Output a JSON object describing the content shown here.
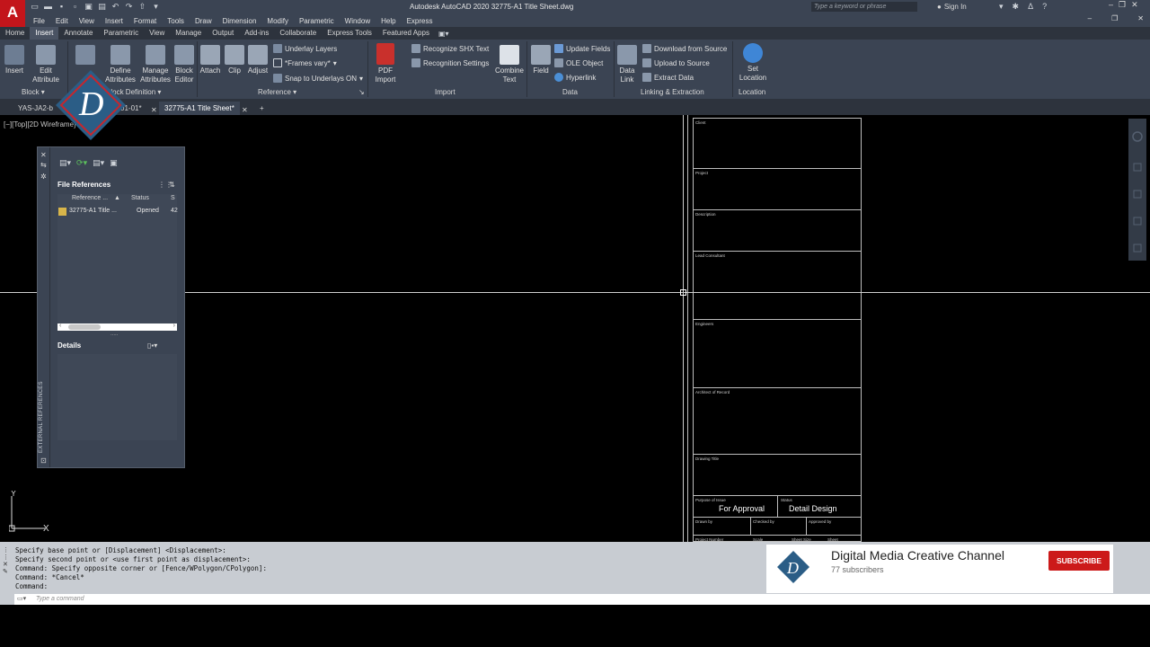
{
  "app": {
    "logo_letter": "A",
    "title": "Autodesk AutoCAD 2020   32775-A1 Title Sheet.dwg",
    "search_placeholder": "Type a keyword or phrase",
    "sign_in": "Sign In"
  },
  "menu": [
    "File",
    "Edit",
    "View",
    "Insert",
    "Format",
    "Tools",
    "Draw",
    "Dimension",
    "Modify",
    "Parametric",
    "Window",
    "Help",
    "Express"
  ],
  "ribbon_tabs": [
    {
      "label": "Home"
    },
    {
      "label": "Insert",
      "active": true
    },
    {
      "label": "Annotate"
    },
    {
      "label": "Parametric"
    },
    {
      "label": "View"
    },
    {
      "label": "Manage"
    },
    {
      "label": "Output"
    },
    {
      "label": "Add-ins"
    },
    {
      "label": "Collaborate"
    },
    {
      "label": "Express Tools"
    },
    {
      "label": "Featured Apps"
    }
  ],
  "ribbon": {
    "insert": "Insert",
    "edit_attribute": "Edit Attribute",
    "define_attributes": "Define Attributes",
    "manage_attributes": "Manage Attributes",
    "block_editor": "Block Editor",
    "attach": "Attach",
    "clip": "Clip",
    "adjust": "Adjust",
    "underlay_layers": "Underlay Layers",
    "frames_vary": "*Frames vary*",
    "snap_to_underlays": "Snap to Underlays ON",
    "pdf_import": "PDF Import",
    "recognize_shx": "Recognize SHX Text",
    "recognition_settings": "Recognition Settings",
    "combine_text": "Combine Text",
    "field": "Field",
    "update_fields": "Update Fields",
    "ole_object": "OLE Object",
    "hyperlink": "Hyperlink",
    "data_link": "Data Link",
    "download_from_source": "Download from Source",
    "upload_to_source": "Upload to Source",
    "extract_data": "Extract  Data",
    "set_location": "Set Location",
    "panels": {
      "block": "Block",
      "block_definition": "Block Definition",
      "reference": "Reference",
      "import": "Import",
      "data": "Data",
      "linking": "Linking & Extraction",
      "location": "Location"
    }
  },
  "doc_tabs": [
    {
      "label": "YAS-JA2-b"
    },
    {
      "label": "01-01*"
    },
    {
      "label": "32775-A1 Title Sheet*",
      "active": true
    }
  ],
  "viewport_label": "[−][Top][2D Wireframe]",
  "xref_palette": {
    "side_title": "EXTERNAL REFERENCES",
    "file_references": "File References",
    "col_reference": "Reference ...",
    "col_status": "Status",
    "col_size": "S",
    "rows": [
      {
        "name": "32775-A1 Title ...",
        "status": "Opened",
        "size": "42"
      }
    ],
    "details": "Details"
  },
  "title_block": {
    "client": "Client",
    "project": "Project",
    "description": "Description",
    "lead_consultant": "Lead Consultant",
    "engineers": "Engineers",
    "architect": "Architect of Record",
    "drawing_title": "Drawing Title",
    "purpose_of_issue": "Purpose of Issue",
    "purpose_value": "For Approval",
    "status": "Status",
    "status_value": "Detail Design",
    "drawn_by": "Drawn by",
    "checked_by": "Checked by",
    "approved_by": "Approved by",
    "project_number": "Project Number",
    "scale": "Scale",
    "sheet_size": "Sheet Size",
    "sheet": "Sheet"
  },
  "ucs": {
    "y": "Y",
    "x": "X"
  },
  "command": {
    "history": [
      "Specify base point or [Displacement] <Displacement>:",
      "Specify second point or <use first point as displacement>:",
      "Command: Specify opposite corner or [Fence/WPolygon/CPolygon]:",
      "Command: *Cancel*",
      "Command:"
    ],
    "placeholder": "Type a command"
  },
  "youtube": {
    "channel": "Digital Media Creative Channel",
    "subscribers": "77 subscribers",
    "subscribe": "SUBSCRIBE",
    "logo_letter": "D"
  },
  "colors": {
    "chrome": "#3b4453",
    "ribbon_active": "#4a5363",
    "canvas": "#000000",
    "subscribe_red": "#cc1a1a",
    "autocad_red": "#c3151b"
  }
}
